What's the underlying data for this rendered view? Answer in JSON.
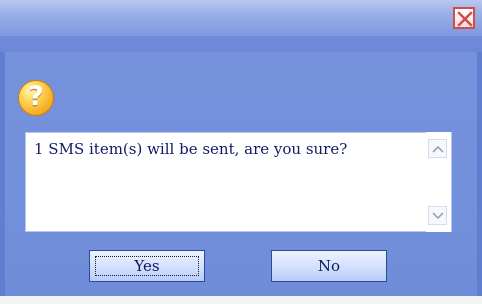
{
  "dialog": {
    "close_icon": "close-icon",
    "status_icon": "question-icon",
    "message": "1 SMS item(s) will be sent, are you sure?",
    "buttons": {
      "yes": "Yes",
      "no": "No"
    },
    "icons": {
      "scroll_up": "chevron-up-icon",
      "scroll_down": "chevron-down-icon"
    }
  },
  "colors": {
    "accent": "#6e8cd8",
    "close": "#d24b4b",
    "text": "#111a66"
  }
}
